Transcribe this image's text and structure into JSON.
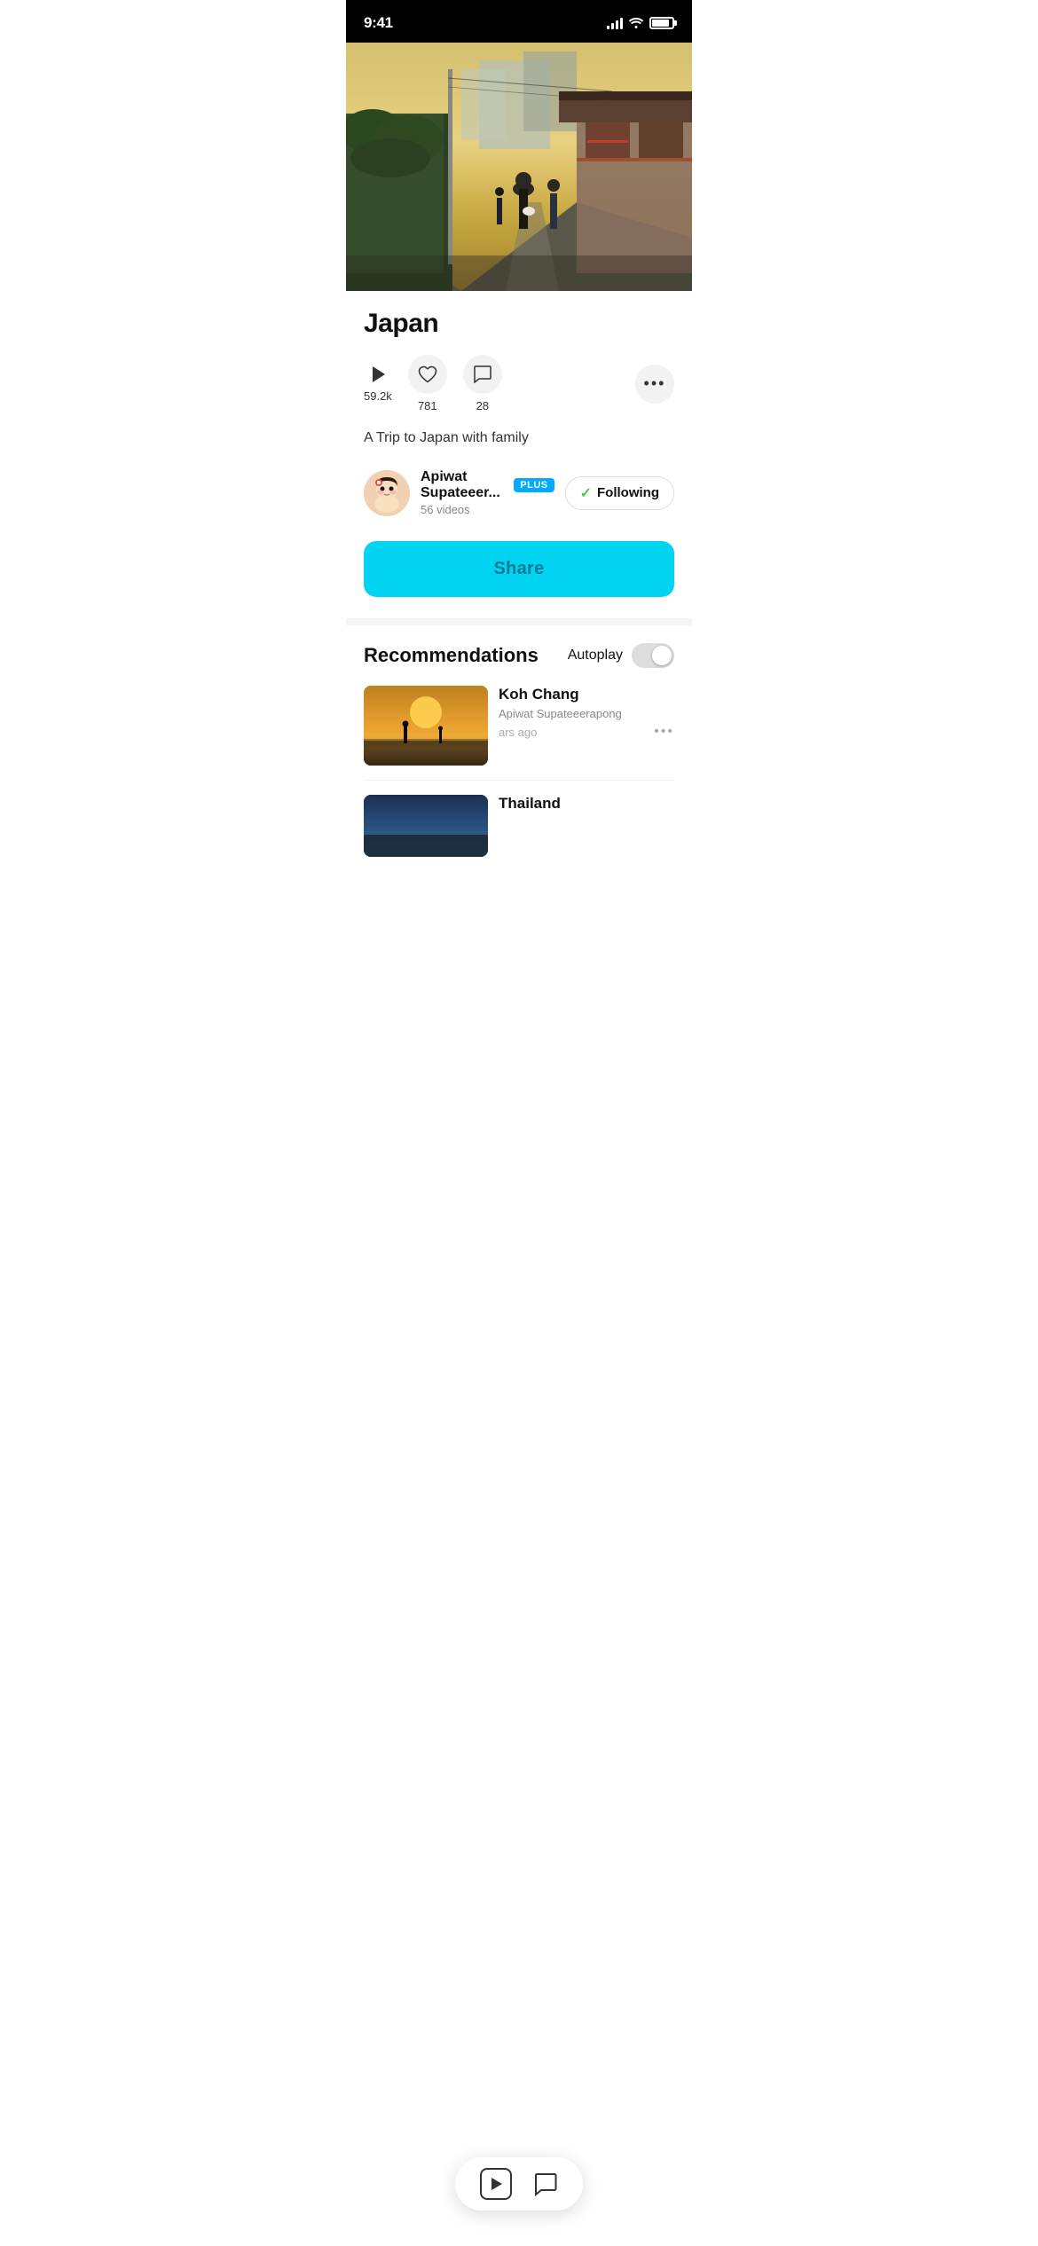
{
  "status_bar": {
    "time": "9:41",
    "signal_bars": 4,
    "wifi": true,
    "battery": 85
  },
  "hero": {
    "alt": "Street scene in Japan"
  },
  "video": {
    "title": "Japan",
    "stats": {
      "plays": "59.2k",
      "likes": "781",
      "comments": "28"
    },
    "description": "A Trip to Japan with family"
  },
  "creator": {
    "name": "Apiwat Supateeer...",
    "badge": "PLUS",
    "videos_count": "56 videos",
    "following": true,
    "following_label": "Following"
  },
  "share_button": {
    "label": "Share"
  },
  "recommendations": {
    "title": "Recommendations",
    "autoplay_label": "Autoplay",
    "autoplay_enabled": false,
    "items": [
      {
        "title": "Koh Chang",
        "creator": "Apiwat Supateeerapong",
        "time": "ars ago",
        "thumb_type": "beach-sunset"
      },
      {
        "title": "Thailand",
        "creator": "",
        "time": "",
        "thumb_type": "ocean"
      }
    ]
  },
  "bottom_player": {
    "play_icon": "▶",
    "comment_icon": "💬"
  }
}
